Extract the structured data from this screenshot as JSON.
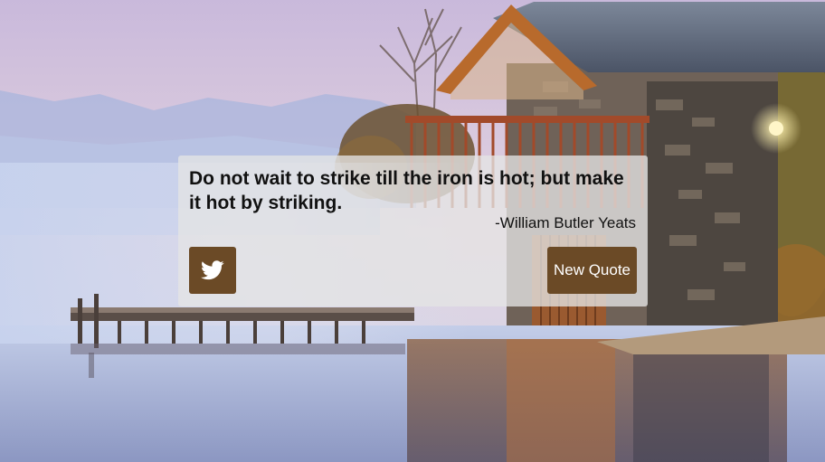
{
  "quote": {
    "text": "Do not wait to strike till the iron is hot; but make it hot by striking.",
    "author": "-William Butler Yeats"
  },
  "buttons": {
    "tweet_icon": "twitter-bird-icon",
    "new_quote_label": "New Quote"
  },
  "colors": {
    "button_bg": "#6b4a26",
    "button_text": "#ffffff",
    "quote_text": "#111111",
    "card_bg": "rgba(228,228,228,0.78)"
  }
}
